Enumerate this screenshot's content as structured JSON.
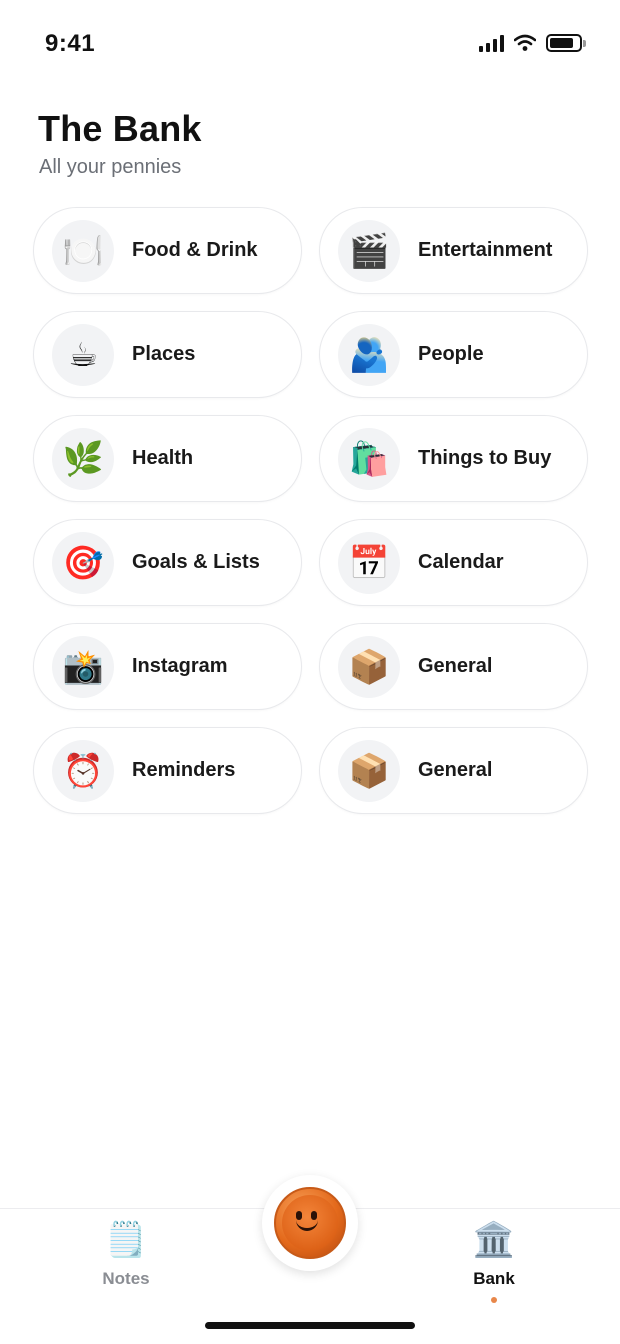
{
  "status": {
    "time": "9:41"
  },
  "header": {
    "title": "The Bank",
    "subtitle": "All your pennies"
  },
  "categories": [
    {
      "label": "Food & Drink",
      "icon": "🍽️",
      "icon_name": "plate-cutlery-icon"
    },
    {
      "label": "Entertainment",
      "icon": "🎬",
      "icon_name": "clapper-board-icon"
    },
    {
      "label": "Places",
      "icon": "☕",
      "icon_name": "coffee-cup-icon"
    },
    {
      "label": "People",
      "icon": "🫂",
      "icon_name": "people-hugging-icon"
    },
    {
      "label": "Health",
      "icon": "🌿",
      "icon_name": "herb-icon"
    },
    {
      "label": "Things to Buy",
      "icon": "🛍️",
      "icon_name": "shopping-bags-icon"
    },
    {
      "label": "Goals & Lists",
      "icon": "🎯",
      "icon_name": "target-icon"
    },
    {
      "label": "Calendar",
      "icon": "📅",
      "icon_name": "calendar-icon"
    },
    {
      "label": "Instagram",
      "icon": "📸",
      "icon_name": "camera-flash-icon"
    },
    {
      "label": "General",
      "icon": "📦",
      "icon_name": "package-icon"
    },
    {
      "label": "Reminders",
      "icon": "⏰",
      "icon_name": "alarm-clock-icon"
    },
    {
      "label": "General",
      "icon": "📦",
      "icon_name": "package-icon"
    }
  ],
  "nav": {
    "notes": {
      "label": "Notes",
      "icon": "🗒️",
      "icon_name": "notepad-icon"
    },
    "bank": {
      "label": "Bank",
      "icon": "🏛️",
      "icon_name": "bank-building-icon"
    },
    "active": "bank"
  },
  "colors": {
    "accent": "#e8874a",
    "coin": "#e46a1c",
    "card_border": "#e8e9ec",
    "icon_bg": "#f2f3f5"
  }
}
